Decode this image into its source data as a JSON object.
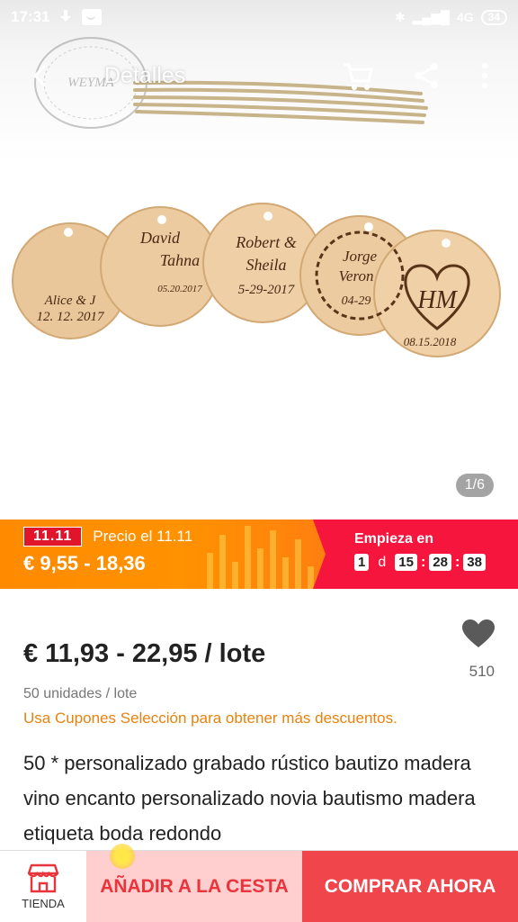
{
  "status_bar": {
    "time": "17:31",
    "network": "4G",
    "battery": "34"
  },
  "topbar": {
    "title": "Detalles",
    "back_icon": "arrow-left-icon",
    "cart_icon": "cart-icon",
    "share_icon": "share-icon",
    "more_icon": "more-vert-icon"
  },
  "hero": {
    "watermark": "WEYMA",
    "tags": [
      "Alice & J 12. 12. 2017",
      "David Tahna 05.20.2017",
      "Robert & Sheila 5-29-2017",
      "Jorge Veron 04-29",
      "HM 08.15.2018"
    ],
    "image_counter": "1/6"
  },
  "promo": {
    "tag": "11.11",
    "label": "Precio el 11.11",
    "price": "€ 9,55 - 18,36",
    "starts_label": "Empieza en",
    "countdown": {
      "days": "1",
      "days_unit": "d",
      "hours": "15",
      "minutes": "28",
      "seconds": "38"
    },
    "colors": {
      "left": "#ff8a00",
      "right": "#f5153d"
    }
  },
  "product": {
    "price": "€ 11,93 - 22,95 / lote",
    "favorites": "510",
    "units": "50 unidades / lote",
    "coupon_text": "Usa Cupones Selección para obtener más descuentos.",
    "title": "50 * personalizado grabado rústico bautizo madera vino encanto personalizado novia bautismo madera etiqueta boda redondo"
  },
  "bottom_bar": {
    "store_label": "TIENDA",
    "add_to_cart": "AÑADIR A LA CESTA",
    "buy_now": "COMPRAR AHORA"
  }
}
